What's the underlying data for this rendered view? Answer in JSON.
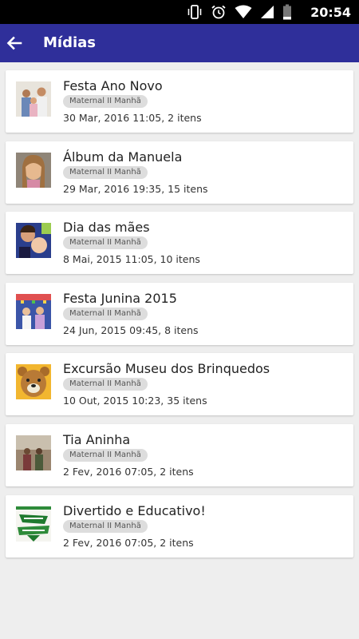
{
  "status_bar": {
    "time": "20:54",
    "icons": [
      "vibrate-icon",
      "alarm-icon",
      "wifi-icon",
      "signal-icon",
      "battery-icon"
    ]
  },
  "app_bar": {
    "title": "Mídias",
    "back_icon": "arrow-back-icon",
    "background": "#2f2f9a"
  },
  "albums": [
    {
      "title": "Festa Ano Novo",
      "class": "Maternal II Manhã",
      "meta": "30 Mar, 2016 11:05, 2 itens",
      "thumb": "family-photo"
    },
    {
      "title": "Álbum da Manuela",
      "class": "Maternal II Manhã",
      "meta": "29 Mar, 2016 19:35, 15 itens",
      "thumb": "child-portrait"
    },
    {
      "title": "Dia das mães",
      "class": "Maternal II Manhã",
      "meta": "8 Mai, 2015 11:05, 10 itens",
      "thumb": "mother-baby"
    },
    {
      "title": "Festa Junina 2015",
      "class": "Maternal II Manhã",
      "meta": "24 Jun, 2015 09:45, 8 itens",
      "thumb": "festival-kids"
    },
    {
      "title": "Excursão Museu dos Brinquedos",
      "class": "Maternal II Manhã",
      "meta": "10 Out, 2015 10:23, 35 itens",
      "thumb": "teddy-bear"
    },
    {
      "title": "Tia Aninha",
      "class": "Maternal II Manhã",
      "meta": "2 Fev, 2016 07:05, 2 itens",
      "thumb": "old-photo"
    },
    {
      "title": "Divertido e Educativo!",
      "class": "Maternal II Manhã",
      "meta": "2 Fev, 2016 07:05, 2 itens",
      "thumb": "green-poster"
    }
  ]
}
